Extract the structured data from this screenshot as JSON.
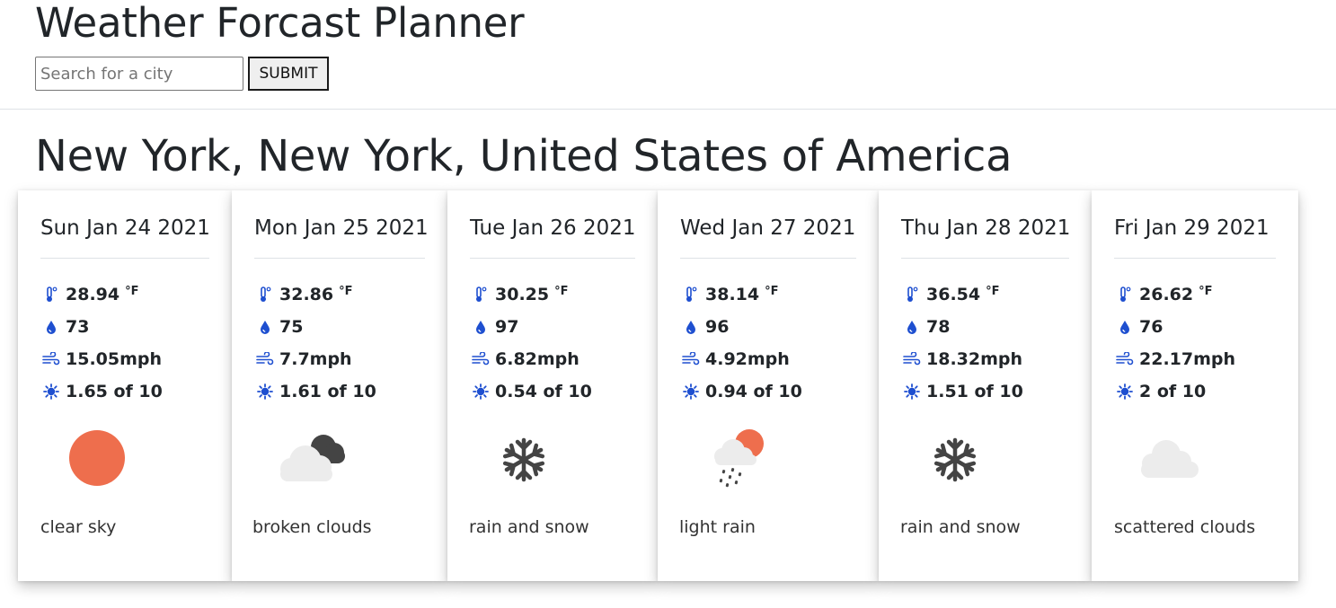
{
  "app": {
    "title": "Weather Forcast Planner"
  },
  "search": {
    "placeholder": "Search for a city",
    "value": "",
    "submit_label": "SUBMIT"
  },
  "location": {
    "name": "New York, New York, United States of America"
  },
  "colors": {
    "icon_blue": "#1e4fd0",
    "sun_orange": "#ee6e4d",
    "cloud_light": "#ececec",
    "cloud_dark": "#444444",
    "snow_dark": "#444444"
  },
  "forecast": [
    {
      "date": "Sun Jan 24 2021",
      "temp": "28.94",
      "temp_unit": "°F",
      "humidity": "73",
      "wind": "15.05mph",
      "uv": "1.65 of 10",
      "icon": "clear-sky-icon",
      "description": "clear sky"
    },
    {
      "date": "Mon Jan 25 2021",
      "temp": "32.86",
      "temp_unit": "°F",
      "humidity": "75",
      "wind": "7.7mph",
      "uv": "1.61 of 10",
      "icon": "broken-clouds-icon",
      "description": "broken clouds"
    },
    {
      "date": "Tue Jan 26 2021",
      "temp": "30.25",
      "temp_unit": "°F",
      "humidity": "97",
      "wind": "6.82mph",
      "uv": "0.54 of 10",
      "icon": "snowflake-icon",
      "description": "rain and snow"
    },
    {
      "date": "Wed Jan 27 2021",
      "temp": "38.14",
      "temp_unit": "°F",
      "humidity": "96",
      "wind": "4.92mph",
      "uv": "0.94 of 10",
      "icon": "light-rain-icon",
      "description": "light rain"
    },
    {
      "date": "Thu Jan 28 2021",
      "temp": "36.54",
      "temp_unit": "°F",
      "humidity": "78",
      "wind": "18.32mph",
      "uv": "1.51 of 10",
      "icon": "snowflake-icon",
      "description": "rain and snow"
    },
    {
      "date": "Fri Jan 29 2021",
      "temp": "26.62",
      "temp_unit": "°F",
      "humidity": "76",
      "wind": "22.17mph",
      "uv": "2 of 10",
      "icon": "scattered-clouds-icon",
      "description": "scattered clouds"
    }
  ]
}
